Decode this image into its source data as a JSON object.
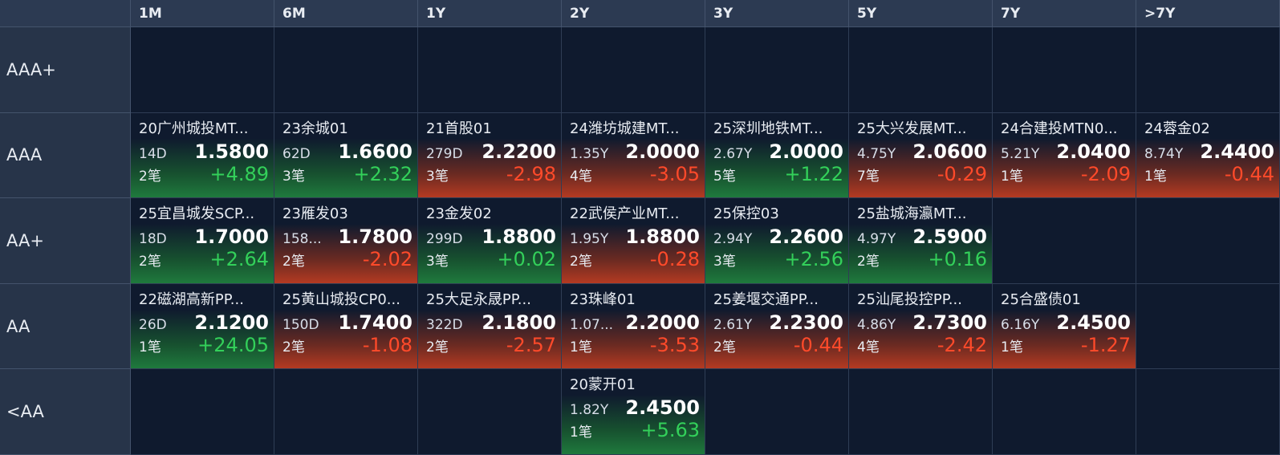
{
  "columns": [
    "1M",
    "6M",
    "1Y",
    "2Y",
    "3Y",
    "5Y",
    "7Y",
    ">7Y"
  ],
  "rows": [
    {
      "label": "AAA+",
      "cells": [
        null,
        null,
        null,
        null,
        null,
        null,
        null,
        null
      ]
    },
    {
      "label": "AAA",
      "cells": [
        {
          "name": "20广州城投MT...",
          "term": "14D",
          "yield": "1.5800",
          "count": "2笔",
          "change": "+4.89",
          "dir": "up"
        },
        {
          "name": "23余城01",
          "term": "62D",
          "yield": "1.6600",
          "count": "3笔",
          "change": "+2.32",
          "dir": "up"
        },
        {
          "name": "21首股01",
          "term": "279D",
          "yield": "2.2200",
          "count": "3笔",
          "change": "-2.98",
          "dir": "down"
        },
        {
          "name": "24潍坊城建MT...",
          "term": "1.35Y",
          "yield": "2.0000",
          "count": "4笔",
          "change": "-3.05",
          "dir": "down"
        },
        {
          "name": "25深圳地铁MT...",
          "term": "2.67Y",
          "yield": "2.0000",
          "count": "5笔",
          "change": "+1.22",
          "dir": "up"
        },
        {
          "name": "25大兴发展MT...",
          "term": "4.75Y",
          "yield": "2.0600",
          "count": "7笔",
          "change": "-0.29",
          "dir": "down"
        },
        {
          "name": "24合建投MTN0...",
          "term": "5.21Y",
          "yield": "2.0400",
          "count": "1笔",
          "change": "-2.09",
          "dir": "down"
        },
        {
          "name": "24蓉金02",
          "term": "8.74Y",
          "yield": "2.4400",
          "count": "1笔",
          "change": "-0.44",
          "dir": "down"
        }
      ]
    },
    {
      "label": "AA+",
      "cells": [
        {
          "name": "25宜昌城发SCP...",
          "term": "18D",
          "yield": "1.7000",
          "count": "2笔",
          "change": "+2.64",
          "dir": "up"
        },
        {
          "name": "23雁发03",
          "term": "158...",
          "yield": "1.7800",
          "count": "2笔",
          "change": "-2.02",
          "dir": "down"
        },
        {
          "name": "23金发02",
          "term": "299D",
          "yield": "1.8800",
          "count": "3笔",
          "change": "+0.02",
          "dir": "up"
        },
        {
          "name": "22武侯产业MT...",
          "term": "1.95Y",
          "yield": "1.8800",
          "count": "2笔",
          "change": "-0.28",
          "dir": "down"
        },
        {
          "name": "25保控03",
          "term": "2.94Y",
          "yield": "2.2600",
          "count": "3笔",
          "change": "+2.56",
          "dir": "up"
        },
        {
          "name": "25盐城海瀛MT...",
          "term": "4.97Y",
          "yield": "2.5900",
          "count": "2笔",
          "change": "+0.16",
          "dir": "up"
        },
        null,
        null
      ]
    },
    {
      "label": "AA",
      "cells": [
        {
          "name": "22磁湖高新PP...",
          "term": "26D",
          "yield": "2.1200",
          "count": "1笔",
          "change": "+24.05",
          "dir": "up"
        },
        {
          "name": "25黄山城投CP0...",
          "term": "150D",
          "yield": "1.7400",
          "count": "2笔",
          "change": "-1.08",
          "dir": "down"
        },
        {
          "name": "25大足永晟PP...",
          "term": "322D",
          "yield": "2.1800",
          "count": "2笔",
          "change": "-2.57",
          "dir": "down"
        },
        {
          "name": "23珠峰01",
          "term": "1.07...",
          "yield": "2.2000",
          "count": "1笔",
          "change": "-3.53",
          "dir": "down"
        },
        {
          "name": "25姜堰交通PP...",
          "term": "2.61Y",
          "yield": "2.2300",
          "count": "2笔",
          "change": "-0.44",
          "dir": "down"
        },
        {
          "name": "25汕尾投控PP...",
          "term": "4.86Y",
          "yield": "2.7300",
          "count": "4笔",
          "change": "-2.42",
          "dir": "down"
        },
        {
          "name": "25合盛债01",
          "term": "6.16Y",
          "yield": "2.4500",
          "count": "1笔",
          "change": "-1.27",
          "dir": "down"
        },
        null
      ]
    },
    {
      "label": "<AA",
      "cells": [
        null,
        null,
        null,
        {
          "name": "20蒙开01",
          "term": "1.82Y",
          "yield": "2.4500",
          "count": "1笔",
          "change": "+5.63",
          "dir": "up"
        },
        null,
        null,
        null,
        null
      ]
    }
  ],
  "colors": {
    "up": "#33d05a",
    "down": "#ff4a2a",
    "background": "#0f1a2e",
    "header": "#2c3a52"
  }
}
